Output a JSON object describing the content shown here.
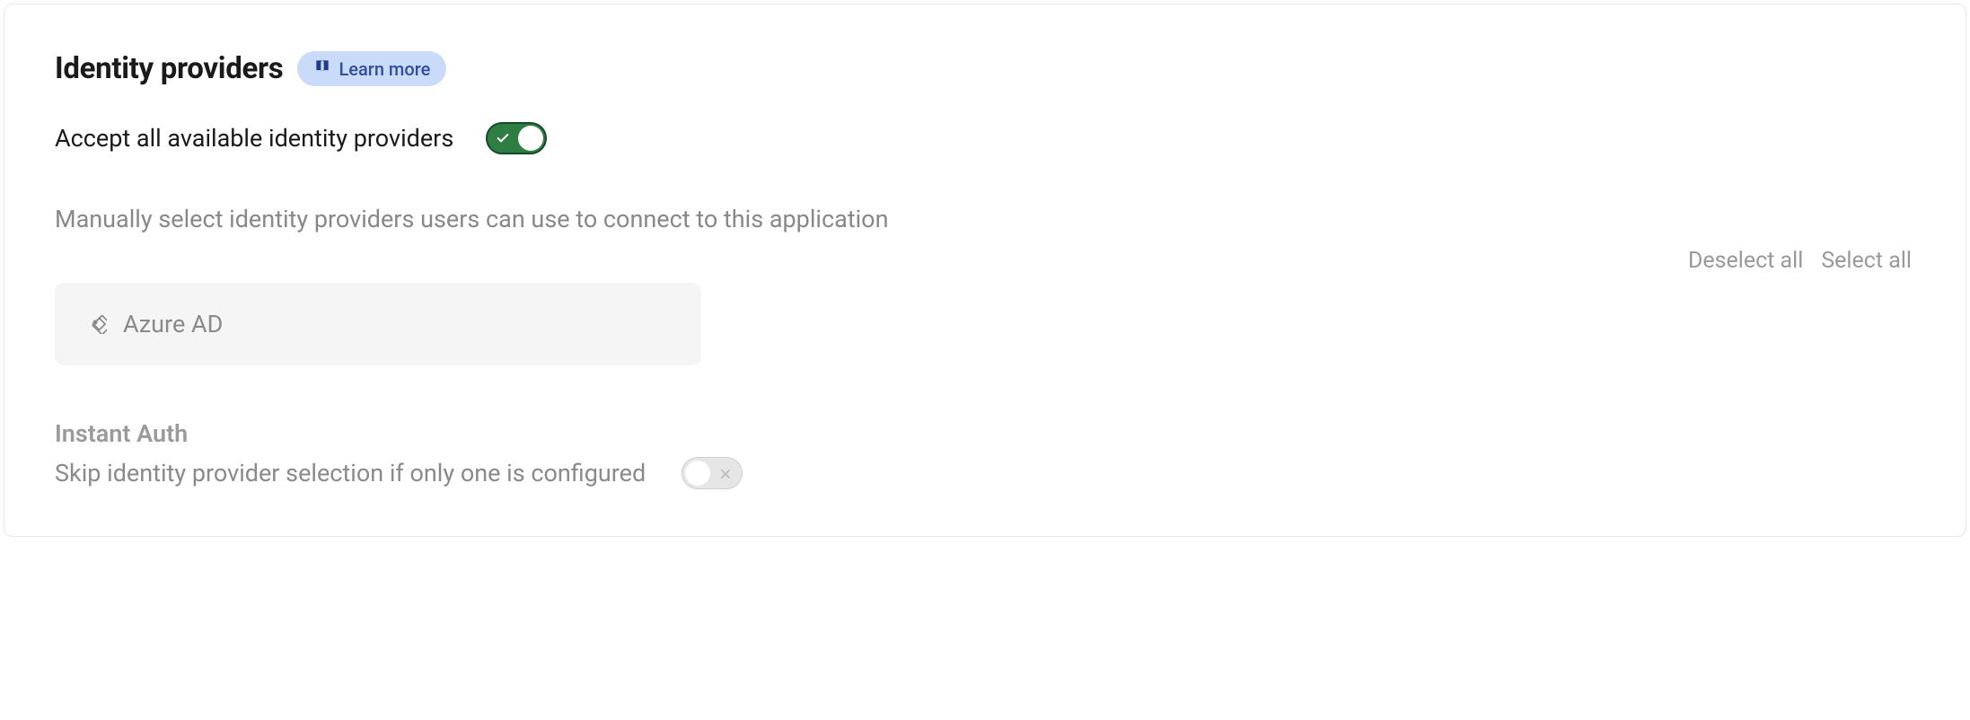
{
  "section": {
    "title": "Identity providers",
    "learn_more": "Learn more"
  },
  "accept_all": {
    "label": "Accept all available identity providers",
    "enabled": true
  },
  "manual": {
    "subtext": "Manually select identity providers users can use to connect to this application",
    "deselect_all": "Deselect all",
    "select_all": "Select all"
  },
  "providers": [
    {
      "name": "Azure AD",
      "icon": "azure-ad-icon"
    }
  ],
  "instant_auth": {
    "title": "Instant Auth",
    "skip_label": "Skip identity provider selection if only one is configured",
    "enabled": false
  }
}
